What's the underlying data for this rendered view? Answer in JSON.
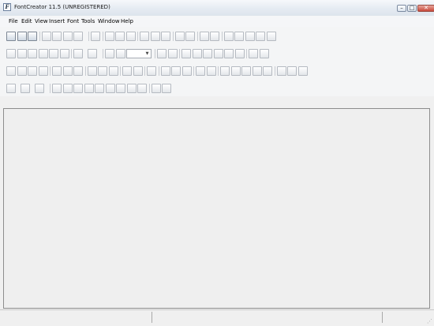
{
  "window": {
    "title": "FontCreator 11.5 (UNREGISTERED)",
    "app_icon_glyph": "F",
    "controls": {
      "minimize": "–",
      "maximize": "□",
      "close": "✕"
    }
  },
  "menu": [
    "File",
    "Edit",
    "View",
    "Insert",
    "Font",
    "Tools",
    "Window",
    "Help"
  ],
  "toolbar": {
    "zoom_value": "",
    "rows": [
      [
        "new-file-icon",
        "open-folder-icon",
        "font-preview-icon",
        "|",
        "save-icon",
        "copy-doc-icon",
        "save-all-icon",
        "export-dropdown-icon",
        "|",
        "print-icon",
        "|",
        "cut-icon",
        "copy-icon",
        "paste-icon",
        "|",
        "undo-icon",
        "redo-icon",
        "refresh-icon",
        "|",
        "glyph-select-icon",
        "glyph-props-icon",
        "|",
        "insert-char-icon",
        "transform-icon",
        "|",
        "validate-icon",
        "metrics-icon",
        "kerning-icon",
        "test-font-icon",
        "preview-window-icon"
      ],
      [
        "select-tool-icon",
        "lasso-tool-icon",
        "hand-tool-icon",
        "knife-tool-icon",
        "pen-tool-icon",
        "fill-tool-icon",
        "|",
        "image-dropdown-icon",
        "layer-dropdown-icon",
        "|",
        "zoom-in-icon",
        "zoom-out-icon",
        "zoom-combo",
        "|",
        "fit-page-icon",
        "zoom-select-icon",
        "|",
        "flip-h-icon",
        "flip-v-icon",
        "add-point-icon",
        "brush-icon",
        "rectangle-icon",
        "ellipse-icon",
        "|",
        "prev-icon",
        "next-icon"
      ],
      [
        "align-left-icon",
        "align-center-icon",
        "align-right-icon",
        "align-top-icon",
        "|",
        "distribute-h-icon",
        "distribute-v-icon",
        "rotate-icon",
        "|",
        "mirror-icon",
        "scale-icon",
        "skew-icon",
        "|",
        "merge-icon",
        "split-icon",
        "|",
        "outline-icon",
        "|",
        "erase-icon",
        "link-icon",
        "unlink-icon",
        "|",
        "bold-icon",
        "italic-icon",
        "|",
        "contour-icon",
        "cw-icon",
        "ccw-icon",
        "reverse-icon",
        "start-point-icon",
        "|",
        "duplicate-icon",
        "group-icon",
        "ungroup-icon"
      ],
      [
        "new-glyph-dropdown-icon",
        "table-dropdown-icon",
        "grid-dropdown-icon",
        "|",
        "grid-1-icon",
        "grid-2-icon",
        "grid-3-icon",
        "grid-4-icon",
        "grid-5-icon",
        "grid-6-icon",
        "grid-7-icon",
        "anchor-icon",
        "anchor-2-icon",
        "|",
        "hint-icon",
        "hint-2-icon"
      ]
    ]
  },
  "statusbar": {
    "sections": [
      "",
      "",
      ""
    ]
  }
}
